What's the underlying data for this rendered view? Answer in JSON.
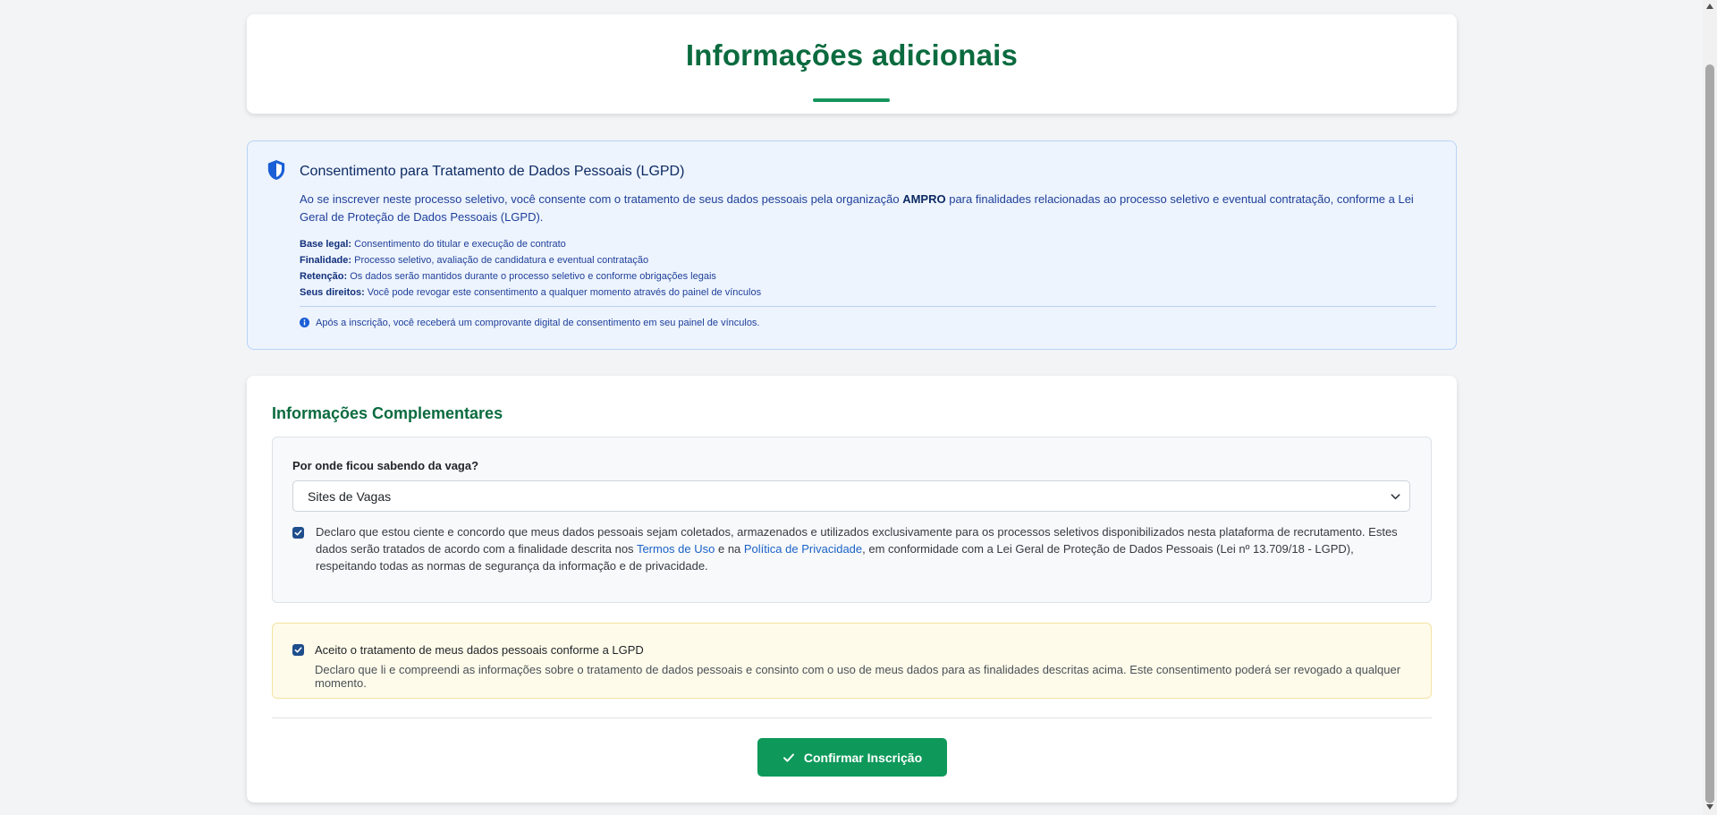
{
  "header": {
    "title": "Informações adicionais"
  },
  "lgpd": {
    "title": "Consentimento para Tratamento de Dados Pessoais (LGPD)",
    "paragraph_before": "Ao se inscrever neste processo seletivo, você consente com o tratamento de seus dados pessoais pela organização ",
    "organization": "AMPRO",
    "paragraph_after": " para finalidades relacionadas ao processo seletivo e eventual contratação, conforme a Lei Geral de Proteção de Dados Pessoais (LGPD).",
    "details": [
      {
        "label": "Base legal:",
        "value": " Consentimento do titular e execução de contrato"
      },
      {
        "label": "Finalidade:",
        "value": " Processo seletivo, avaliação de candidatura e eventual contratação"
      },
      {
        "label": "Retenção:",
        "value": " Os dados serão mantidos durante o processo seletivo e conforme obrigações legais"
      },
      {
        "label": "Seus direitos:",
        "value": " Você pode revogar este consentimento a qualquer momento através do painel de vínculos"
      }
    ],
    "note": "Após a inscrição, você receberá um comprovante digital de consentimento em seu painel de vínculos."
  },
  "form": {
    "section_title": "Informações Complementares",
    "source_label": "Por onde ficou sabendo da vaga?",
    "source_value": "Sites de Vagas",
    "declaration": {
      "part1": "Declaro que estou ciente e concordo que meus dados pessoais sejam coletados, armazenados e utilizados exclusivamente para os processos seletivos disponibilizados nesta plataforma de recrutamento. Estes dados serão tratados de acordo com a finalidade descrita nos ",
      "terms_link": "Termos de Uso",
      "part2": " e na ",
      "privacy_link": "Política de Privacidade",
      "part3": ", em conformidade com a Lei Geral de Proteção de Dados Pessoais (Lei nº 13.709/18 - LGPD), respeitando todas as normas de segurança da informação e de privacidade.",
      "checked": true
    },
    "consent": {
      "title": "Aceito o tratamento de meus dados pessoais conforme a LGPD",
      "description": "Declaro que li e compreendi as informações sobre o tratamento de dados pessoais e consinto com o uso de meus dados para as finalidades descritas acima. Este consentimento poderá ser revogado a qualquer momento.",
      "checked": true
    },
    "confirm_label": "Confirmar Inscrição"
  },
  "icons": {
    "lgpd": "shield-icon",
    "note": "info-icon",
    "select": "chevron-down-icon",
    "button": "check-icon"
  },
  "colors": {
    "brand_green": "#0b6b3f",
    "button_green": "#0e995a",
    "info_blue": "#1f3f99",
    "link_blue": "#1a62c8",
    "warning_bg": "#fffbea"
  }
}
